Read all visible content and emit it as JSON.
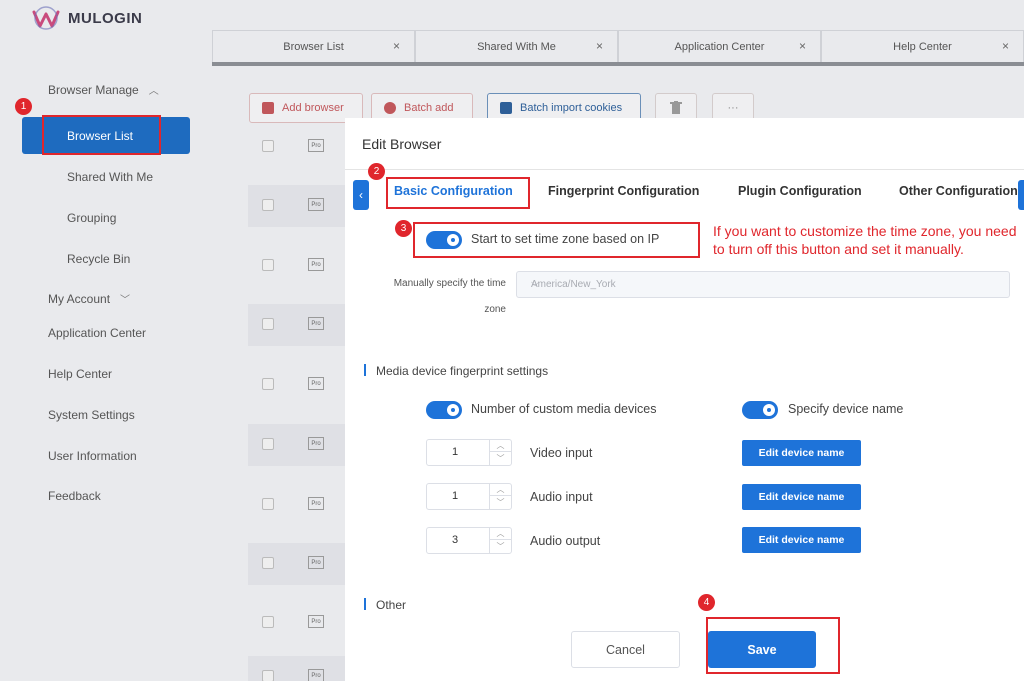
{
  "app": {
    "logo_text": "MULOGIN"
  },
  "colors": {
    "accent": "#1e73d9",
    "sidebar_active": "#1e6bbf",
    "annotation": "#e0262c"
  },
  "tabs": [
    {
      "label": "Browser List",
      "close": "×"
    },
    {
      "label": "Shared With Me",
      "close": "×"
    },
    {
      "label": "Application Center",
      "close": "×"
    },
    {
      "label": "Help Center",
      "close": "×"
    }
  ],
  "sidebar": {
    "browser_manage": "Browser Manage",
    "browser_list": "Browser List",
    "shared_with_me": "Shared With Me",
    "grouping": "Grouping",
    "recycle_bin": "Recycle Bin",
    "my_account": "My Account",
    "application_center": "Application Center",
    "help_center": "Help Center",
    "system_settings": "System Settings",
    "user_information": "User Information",
    "feedback": "Feedback"
  },
  "toolbar": {
    "add_browser": "Add browser",
    "batch_add": "Batch add",
    "batch_import_cookies": "Batch import cookies",
    "more": "···"
  },
  "rows": {
    "pro_label": "Pro"
  },
  "modal": {
    "title": "Edit Browser",
    "tabs": {
      "basic": "Basic Configuration",
      "fingerprint": "Fingerprint Configuration",
      "plugin": "Plugin Configuration",
      "other": "Other Configuration"
    },
    "nav_prev": "‹",
    "timezone_toggle_label": "Start to set time zone based on IP",
    "manual_tz_label_1": "Manually specify the time",
    "manual_tz_label_2": "zone",
    "manual_tz_value": "America/New_York",
    "select_arrow": "⌵",
    "media_section_title": "Media device fingerprint settings",
    "custom_media_label": "Number of custom media devices",
    "specify_name_label": "Specify device name",
    "devices": [
      {
        "value": "1",
        "label": "Video input",
        "button": "Edit device name"
      },
      {
        "value": "1",
        "label": "Audio input",
        "button": "Edit device name"
      },
      {
        "value": "3",
        "label": "Audio output",
        "button": "Edit device name"
      }
    ],
    "other_section_title": "Other",
    "cancel": "Cancel",
    "save": "Save"
  },
  "annotations": {
    "badges": [
      "1",
      "2",
      "3",
      "4"
    ],
    "note": "If you want to customize the time zone, you need to turn off this button and set it manually."
  }
}
